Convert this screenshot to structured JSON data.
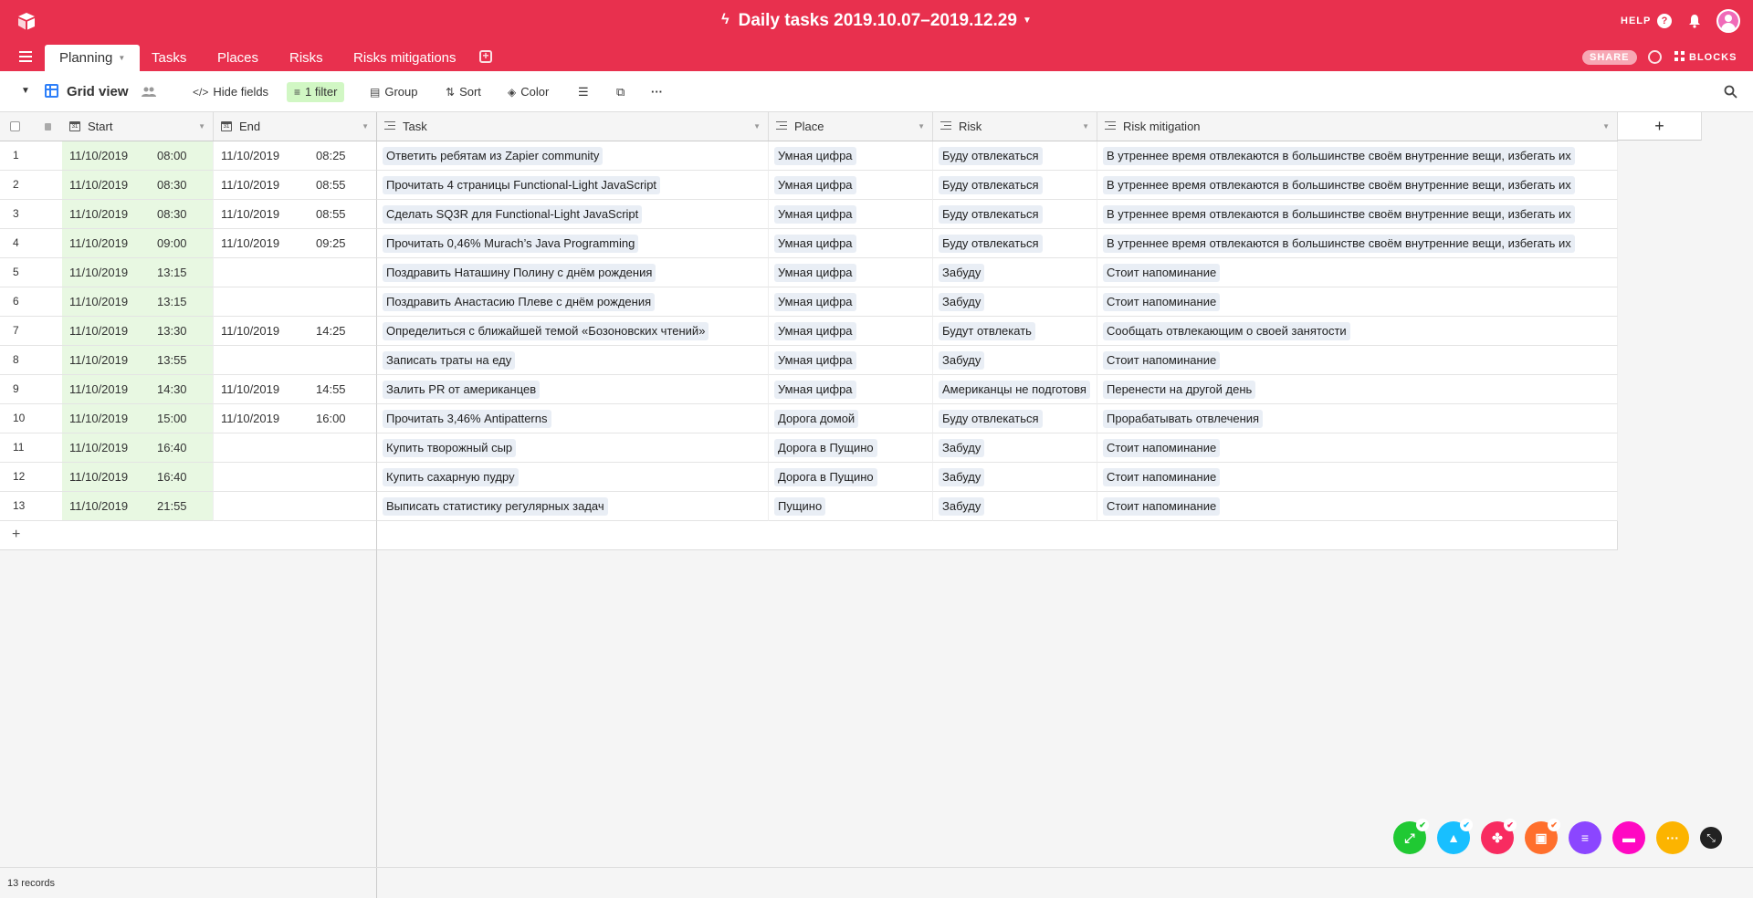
{
  "app": {
    "base_title": "Daily tasks 2019.10.07–2019.12.29",
    "help_label": "HELP",
    "share_label": "SHARE",
    "blocks_label": "BLOCKS",
    "accent_color": "#e8304e"
  },
  "tabs": [
    {
      "label": "Planning",
      "active": true
    },
    {
      "label": "Tasks",
      "active": false
    },
    {
      "label": "Places",
      "active": false
    },
    {
      "label": "Risks",
      "active": false
    },
    {
      "label": "Risks mitigations",
      "active": false
    }
  ],
  "view": {
    "name": "Grid view",
    "hide_fields_label": "Hide fields",
    "filter_label": "1 filter",
    "group_label": "Group",
    "sort_label": "Sort",
    "color_label": "Color"
  },
  "columns": {
    "start": "Start",
    "end": "End",
    "task": "Task",
    "place": "Place",
    "risk": "Risk",
    "risk_mitigation": "Risk mitigation"
  },
  "rows": [
    {
      "n": "1",
      "start_date": "11/10/2019",
      "start_time": "08:00",
      "end_date": "11/10/2019",
      "end_time": "08:25",
      "task": "Ответить ребятам из Zapier community",
      "place": "Умная цифра",
      "risk": "Буду отвлекаться",
      "mitigation": "В утреннее время отвлекаются в большинстве своём внутренние вещи, избегать их"
    },
    {
      "n": "2",
      "start_date": "11/10/2019",
      "start_time": "08:30",
      "end_date": "11/10/2019",
      "end_time": "08:55",
      "task": "Прочитать 4 страницы Functional-Light JavaScript",
      "place": "Умная цифра",
      "risk": "Буду отвлекаться",
      "mitigation": "В утреннее время отвлекаются в большинстве своём внутренние вещи, избегать их"
    },
    {
      "n": "3",
      "start_date": "11/10/2019",
      "start_time": "08:30",
      "end_date": "11/10/2019",
      "end_time": "08:55",
      "task": "Сделать SQ3R для Functional-Light JavaScript",
      "place": "Умная цифра",
      "risk": "Буду отвлекаться",
      "mitigation": "В утреннее время отвлекаются в большинстве своём внутренние вещи, избегать их"
    },
    {
      "n": "4",
      "start_date": "11/10/2019",
      "start_time": "09:00",
      "end_date": "11/10/2019",
      "end_time": "09:25",
      "task": "Прочитать 0,46% Murach’s Java Programming",
      "place": "Умная цифра",
      "risk": "Буду отвлекаться",
      "mitigation": "В утреннее время отвлекаются в большинстве своём внутренние вещи, избегать их"
    },
    {
      "n": "5",
      "start_date": "11/10/2019",
      "start_time": "13:15",
      "end_date": "",
      "end_time": "",
      "task": "Поздравить Наташину Полину с днём рождения",
      "place": "Умная цифра",
      "risk": "Забуду",
      "mitigation": "Стоит напоминание"
    },
    {
      "n": "6",
      "start_date": "11/10/2019",
      "start_time": "13:15",
      "end_date": "",
      "end_time": "",
      "task": "Поздравить Анастасию Плеве с днём рождения",
      "place": "Умная цифра",
      "risk": "Забуду",
      "mitigation": "Стоит напоминание"
    },
    {
      "n": "7",
      "start_date": "11/10/2019",
      "start_time": "13:30",
      "end_date": "11/10/2019",
      "end_time": "14:25",
      "task": "Определиться с ближайшей темой «Бозоновских чтений»",
      "place": "Умная цифра",
      "risk": "Будут отвлекать",
      "mitigation": "Сообщать отвлекающим о своей занятости"
    },
    {
      "n": "8",
      "start_date": "11/10/2019",
      "start_time": "13:55",
      "end_date": "",
      "end_time": "",
      "task": "Записать траты на еду",
      "place": "Умная цифра",
      "risk": "Забуду",
      "mitigation": "Стоит напоминание"
    },
    {
      "n": "9",
      "start_date": "11/10/2019",
      "start_time": "14:30",
      "end_date": "11/10/2019",
      "end_time": "14:55",
      "task": "Залить PR от американцев",
      "place": "Умная цифра",
      "risk": "Американцы не подготовя",
      "mitigation": "Перенести на другой день"
    },
    {
      "n": "10",
      "start_date": "11/10/2019",
      "start_time": "15:00",
      "end_date": "11/10/2019",
      "end_time": "16:00",
      "task": "Прочитать 3,46% Antipatterns",
      "place": "Дорога домой",
      "risk": "Буду отвлекаться",
      "mitigation": "Прорабатывать отвлечения"
    },
    {
      "n": "11",
      "start_date": "11/10/2019",
      "start_time": "16:40",
      "end_date": "",
      "end_time": "",
      "task": "Купить творожный сыр",
      "place": "Дорога в Пущино",
      "risk": "Забуду",
      "mitigation": "Стоит напоминание"
    },
    {
      "n": "12",
      "start_date": "11/10/2019",
      "start_time": "16:40",
      "end_date": "",
      "end_time": "",
      "task": "Купить сахарную пудру",
      "place": "Дорога в Пущино",
      "risk": "Забуду",
      "mitigation": "Стоит напоминание"
    },
    {
      "n": "13",
      "start_date": "11/10/2019",
      "start_time": "21:55",
      "end_date": "",
      "end_time": "",
      "task": "Выписать статистику регулярных задач",
      "place": "Пущино",
      "risk": "Забуду",
      "mitigation": "Стоит напоминание"
    }
  ],
  "footer": {
    "records_label": "13 records"
  },
  "blocks": [
    {
      "icon": "expand-icon",
      "color": "#20c933"
    },
    {
      "icon": "shapes-icon",
      "color": "#18bfff"
    },
    {
      "icon": "apps-icon",
      "color": "#f82b60"
    },
    {
      "icon": "image-icon",
      "color": "#ff6f2c"
    },
    {
      "icon": "list-icon",
      "color": "#8b46ff"
    },
    {
      "icon": "chat-icon",
      "color": "#ff08c2"
    },
    {
      "icon": "more-icon",
      "color": "#fcb400"
    }
  ]
}
